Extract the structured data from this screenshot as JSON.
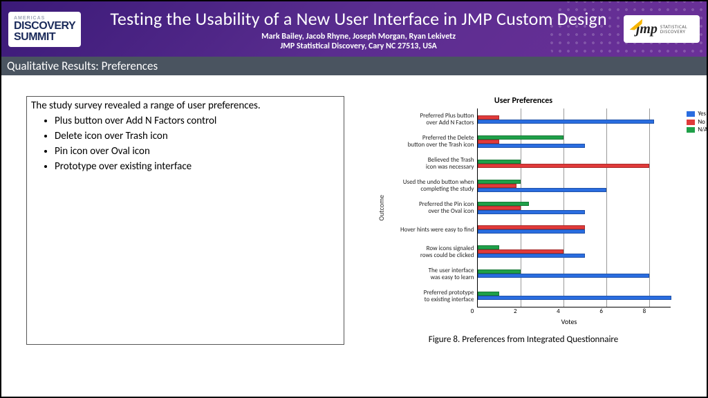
{
  "header": {
    "logo_summit": {
      "line1": "AMERICAS",
      "line2": "DISCOVERY",
      "line3": "SUMMIT"
    },
    "title": "Testing the Usability of a New User Interface in JMP Custom Design",
    "authors": "Mark Bailey, Jacob Rhyne, Joseph Morgan, Ryan Lekivetz",
    "affiliation": "JMP Statistical Discovery, Cary NC 27513, USA",
    "logo_jmp": {
      "mark": "jmp",
      "sub1": "STATISTICAL",
      "sub2": "DISCOVERY"
    }
  },
  "subheader": "Qualitative Results: Preferences",
  "textbox": {
    "lead": "The study survey revealed a range of user preferences.",
    "items": [
      "Plus button over Add N Factors control",
      "Delete icon over Trash icon",
      "Pin icon over Oval icon",
      "Prototype over existing interface"
    ]
  },
  "chart_data": {
    "type": "bar",
    "orientation": "horizontal",
    "title": "User Preferences",
    "xlabel": "Votes",
    "ylabel": "Outcome",
    "xlim": [
      0,
      9
    ],
    "xticks": [
      0,
      2,
      4,
      6,
      8
    ],
    "legend": {
      "position": "right",
      "entries": [
        "Yes",
        "No",
        "N/A"
      ]
    },
    "categories": [
      "Preferred Plus button over Add N Factors",
      "Preferred the Delete button over the Trash icon",
      "Believed the Trash icon was necessary",
      "Used the undo button when completing the study",
      "Preferred the Pin icon over the Oval icon",
      "Hover hints were easy to find",
      "Row icons signaled rows could be clicked",
      "The user interface was easy to learn",
      "Preferred prototype to existing interface"
    ],
    "categories_2line": [
      [
        "Preferred Plus button",
        "over Add N Factors"
      ],
      [
        "Preferred the Delete",
        "button over the Trash icon"
      ],
      [
        "Believed the Trash",
        "icon was necessary"
      ],
      [
        "Used the undo button when",
        "completing the study"
      ],
      [
        "Preferred the Pin icon",
        "over the Oval icon"
      ],
      [
        "Hover hints were easy to find",
        ""
      ],
      [
        "Row icons signaled",
        "rows could be clicked"
      ],
      [
        "The user interface",
        "was easy to learn"
      ],
      [
        "Preferred prototype",
        "to existing interface"
      ]
    ],
    "series": [
      {
        "name": "N/A",
        "color": "#1fa049",
        "values": [
          0,
          4,
          2,
          2,
          2.4,
          0,
          1,
          2,
          1
        ]
      },
      {
        "name": "No",
        "color": "#e03a3a",
        "values": [
          1,
          1,
          8,
          1.8,
          2,
          5,
          4,
          0,
          0
        ]
      },
      {
        "name": "Yes",
        "color": "#2a6de0",
        "values": [
          8.2,
          5,
          0,
          6,
          5,
          5,
          5,
          8,
          9
        ]
      }
    ],
    "caption": "Figure 8. Preferences from Integrated Questionnaire"
  }
}
